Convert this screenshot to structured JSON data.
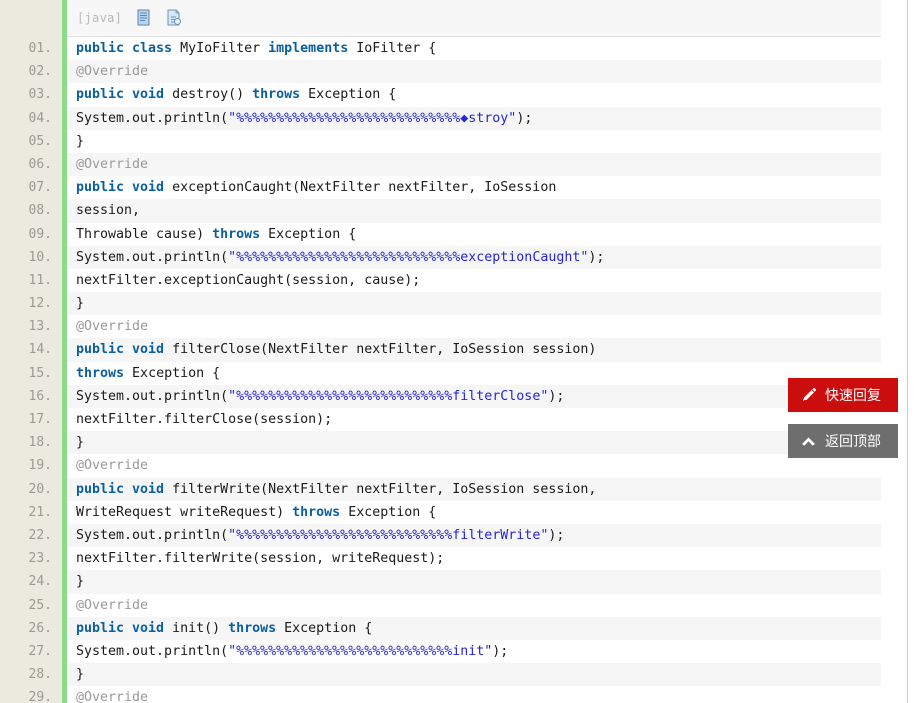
{
  "code_block": {
    "language_tag": "[java]",
    "icons": [
      {
        "name": "copy-code-icon",
        "title": "copy"
      },
      {
        "name": "view-source-icon",
        "title": "view source"
      }
    ],
    "accent_color": "#8bdb8b",
    "gutter_color": "#ebeade",
    "lines": [
      {
        "num": "01.",
        "tokens": [
          {
            "t": "kw",
            "v": "public class"
          },
          {
            "t": "pln",
            "v": " MyIoFilter "
          },
          {
            "t": "kw",
            "v": "implements"
          },
          {
            "t": "pln",
            "v": " IoFilter {"
          }
        ]
      },
      {
        "num": "02.",
        "tokens": [
          {
            "t": "ann",
            "v": "@Override"
          }
        ]
      },
      {
        "num": "03.",
        "tokens": [
          {
            "t": "kw",
            "v": "public void"
          },
          {
            "t": "pln",
            "v": " destroy() "
          },
          {
            "t": "kw",
            "v": "throws"
          },
          {
            "t": "pln",
            "v": " Exception {"
          }
        ]
      },
      {
        "num": "04.",
        "tokens": [
          {
            "t": "pln",
            "v": "System.out.println("
          },
          {
            "t": "str",
            "v": "\"%%%%%%%%%%%%%%%%%%%%%%%%%%%%◆stroy\""
          },
          {
            "t": "pln",
            "v": ");"
          }
        ]
      },
      {
        "num": "05.",
        "tokens": [
          {
            "t": "pln",
            "v": "}"
          }
        ]
      },
      {
        "num": "06.",
        "tokens": [
          {
            "t": "ann",
            "v": "@Override"
          }
        ]
      },
      {
        "num": "07.",
        "tokens": [
          {
            "t": "kw",
            "v": "public void"
          },
          {
            "t": "pln",
            "v": " exceptionCaught(NextFilter nextFilter, IoSession"
          }
        ]
      },
      {
        "num": "08.",
        "tokens": [
          {
            "t": "pln",
            "v": "session,"
          }
        ]
      },
      {
        "num": "09.",
        "tokens": [
          {
            "t": "pln",
            "v": "Throwable cause) "
          },
          {
            "t": "kw",
            "v": "throws"
          },
          {
            "t": "pln",
            "v": " Exception {"
          }
        ]
      },
      {
        "num": "10.",
        "tokens": [
          {
            "t": "pln",
            "v": "System.out.println("
          },
          {
            "t": "str",
            "v": "\"%%%%%%%%%%%%%%%%%%%%%%%%%%%%exceptionCaught\""
          },
          {
            "t": "pln",
            "v": ");"
          }
        ]
      },
      {
        "num": "11.",
        "tokens": [
          {
            "t": "pln",
            "v": "nextFilter.exceptionCaught(session, cause);"
          }
        ]
      },
      {
        "num": "12.",
        "tokens": [
          {
            "t": "pln",
            "v": "}"
          }
        ]
      },
      {
        "num": "13.",
        "tokens": [
          {
            "t": "ann",
            "v": "@Override"
          }
        ]
      },
      {
        "num": "14.",
        "tokens": [
          {
            "t": "kw",
            "v": "public void"
          },
          {
            "t": "pln",
            "v": " filterClose(NextFilter nextFilter, IoSession session)"
          }
        ]
      },
      {
        "num": "15.",
        "tokens": [
          {
            "t": "kw",
            "v": "throws"
          },
          {
            "t": "pln",
            "v": " Exception {"
          }
        ]
      },
      {
        "num": "16.",
        "tokens": [
          {
            "t": "pln",
            "v": "System.out.println("
          },
          {
            "t": "str",
            "v": "\"%%%%%%%%%%%%%%%%%%%%%%%%%%%filterClose\""
          },
          {
            "t": "pln",
            "v": ");"
          }
        ]
      },
      {
        "num": "17.",
        "tokens": [
          {
            "t": "pln",
            "v": "nextFilter.filterClose(session);"
          }
        ]
      },
      {
        "num": "18.",
        "tokens": [
          {
            "t": "pln",
            "v": "}"
          }
        ]
      },
      {
        "num": "19.",
        "tokens": [
          {
            "t": "ann",
            "v": "@Override"
          }
        ]
      },
      {
        "num": "20.",
        "tokens": [
          {
            "t": "kw",
            "v": "public void"
          },
          {
            "t": "pln",
            "v": " filterWrite(NextFilter nextFilter, IoSession session,"
          }
        ]
      },
      {
        "num": "21.",
        "tokens": [
          {
            "t": "pln",
            "v": "WriteRequest writeRequest) "
          },
          {
            "t": "kw",
            "v": "throws"
          },
          {
            "t": "pln",
            "v": " Exception {"
          }
        ]
      },
      {
        "num": "22.",
        "tokens": [
          {
            "t": "pln",
            "v": "System.out.println("
          },
          {
            "t": "str",
            "v": "\"%%%%%%%%%%%%%%%%%%%%%%%%%%%filterWrite\""
          },
          {
            "t": "pln",
            "v": ");"
          }
        ]
      },
      {
        "num": "23.",
        "tokens": [
          {
            "t": "pln",
            "v": "nextFilter.filterWrite(session, writeRequest);"
          }
        ]
      },
      {
        "num": "24.",
        "tokens": [
          {
            "t": "pln",
            "v": "}"
          }
        ]
      },
      {
        "num": "25.",
        "tokens": [
          {
            "t": "ann",
            "v": "@Override"
          }
        ]
      },
      {
        "num": "26.",
        "tokens": [
          {
            "t": "kw",
            "v": "public void"
          },
          {
            "t": "pln",
            "v": " init() "
          },
          {
            "t": "kw",
            "v": "throws"
          },
          {
            "t": "pln",
            "v": " Exception {"
          }
        ]
      },
      {
        "num": "27.",
        "tokens": [
          {
            "t": "pln",
            "v": "System.out.println("
          },
          {
            "t": "str",
            "v": "\"%%%%%%%%%%%%%%%%%%%%%%%%%%%init\""
          },
          {
            "t": "pln",
            "v": ");"
          }
        ]
      },
      {
        "num": "28.",
        "tokens": [
          {
            "t": "pln",
            "v": "}"
          }
        ]
      },
      {
        "num": "29.",
        "tokens": [
          {
            "t": "ann",
            "v": "@Override"
          }
        ]
      }
    ]
  },
  "floating_buttons": {
    "quick_reply": {
      "label": "快速回复",
      "color": "#cc0d0d",
      "icon": "pencil-icon"
    },
    "back_to_top": {
      "label": "返回顶部",
      "color": "#6e6e6e",
      "icon": "chevron-up-icon"
    }
  }
}
